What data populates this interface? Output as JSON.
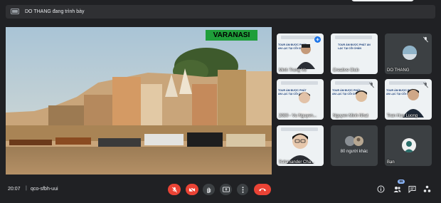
{
  "banner": {
    "presenter_text": "DO THANG đang trình bày"
  },
  "stage": {
    "label": "VARANASI"
  },
  "tiles": [
    {
      "name": "Minh Trung Vo",
      "speaking": true
    },
    {
      "name": "Creative Club"
    },
    {
      "name": "DO THANG"
    },
    {
      "name": "2080 - Vu Nguyen..."
    },
    {
      "name": "Nguyen Minh Nhat"
    },
    {
      "name": "Tran Huu Luong"
    },
    {
      "name": "Salamander Cha..."
    },
    {
      "name": "80 người khác"
    },
    {
      "name": "Bạn"
    }
  ],
  "poster": {
    "text": "TOUR ẨM ĐƯỢC PHÁT AN LẠC TẠI CÕI CHÂN"
  },
  "bottombar": {
    "time": "20:07",
    "separator": "|",
    "meeting_code": "qco-sfbh-uui",
    "participant_count": "89"
  },
  "colors": {
    "end_call": "#ea4335",
    "muted": "#ea4335",
    "background": "#202124",
    "accent": "#1a73e8"
  },
  "icons": [
    "presentation-icon",
    "mic-off-icon",
    "camera-off-icon",
    "raise-hand-icon",
    "present-icon",
    "more-icon",
    "end-call-icon",
    "info-icon",
    "people-icon",
    "chat-icon",
    "activities-icon"
  ]
}
